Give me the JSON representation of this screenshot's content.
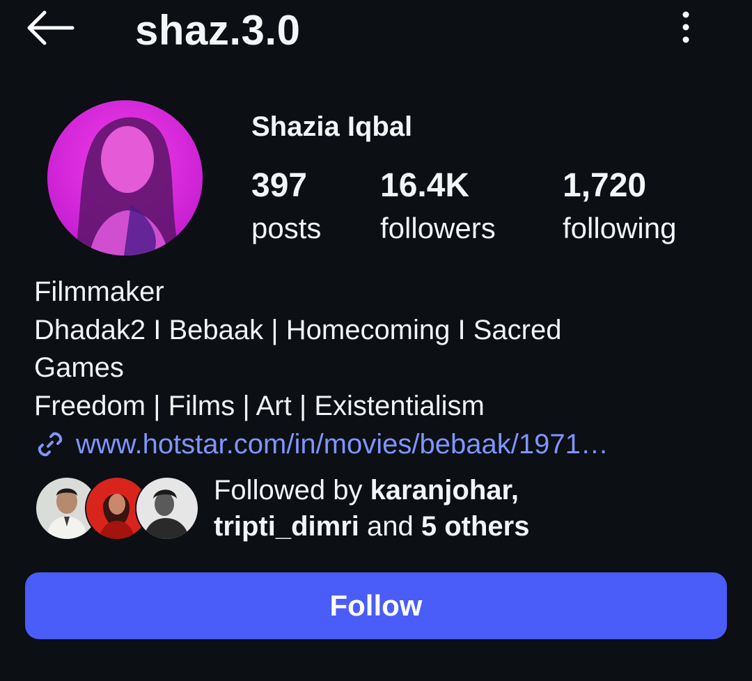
{
  "header": {
    "username": "shaz.3.0",
    "back_icon": "arrow-left-icon",
    "menu_icon": "more-vertical-icon"
  },
  "profile": {
    "name": "Shazia Iqbal",
    "stats": [
      {
        "value": "397",
        "label": "posts"
      },
      {
        "value": "16.4K",
        "label": "followers"
      },
      {
        "value": "1,720",
        "label": "following"
      }
    ]
  },
  "bio": {
    "lines": [
      "Filmmaker",
      "Dhadak2 I Bebaak | Homecoming I Sacred",
      "Games",
      "Freedom | Films | Art | Existentialism"
    ],
    "link": "www.hotstar.com/in/movies/bebaak/1971…",
    "link_icon": "link-icon"
  },
  "followed_by": {
    "prefix": "Followed by ",
    "user1": "karanjohar",
    "sep": ",",
    "user2": "tripti_dimri",
    "middle": " and ",
    "others": "5 others"
  },
  "actions": {
    "follow_label": "Follow"
  },
  "colors": {
    "background": "#0c0f14",
    "accent": "#4a5df9",
    "link": "#7f95ff",
    "text": "#f3f5f7"
  }
}
